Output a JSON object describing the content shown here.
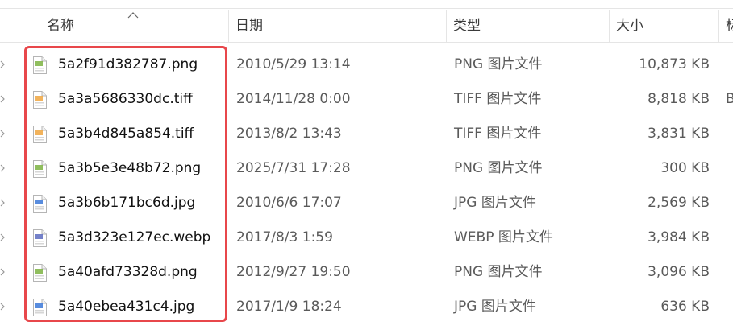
{
  "columns": {
    "name": "名称",
    "date": "日期",
    "type": "类型",
    "size": "大小",
    "more": "标"
  },
  "files": [
    {
      "name": "5a2f91d382787.png",
      "date": "2010/5/29 13:14",
      "type": "PNG 图片文件",
      "size": "10,873 KB",
      "extra": "",
      "icon": "png-file-icon",
      "icon_color": "#7cb342"
    },
    {
      "name": "5a3a5686330dc.tiff",
      "date": "2014/11/28 0:00",
      "type": "TIFF 图片文件",
      "size": "8,818 KB",
      "extra": "B",
      "icon": "tiff-file-icon",
      "icon_color": "#f0a640"
    },
    {
      "name": "5a3b4d845a854.tiff",
      "date": "2013/8/2 13:43",
      "type": "TIFF 图片文件",
      "size": "3,831 KB",
      "extra": "",
      "icon": "tiff-file-icon",
      "icon_color": "#f0a640"
    },
    {
      "name": "5a3b5e3e48b72.png",
      "date": "2025/7/31 17:28",
      "type": "PNG 图片文件",
      "size": "300 KB",
      "extra": "",
      "icon": "png-file-icon",
      "icon_color": "#7cb342"
    },
    {
      "name": "5a3b6b171bc6d.jpg",
      "date": "2010/6/6 17:07",
      "type": "JPG 图片文件",
      "size": "2,569 KB",
      "extra": "",
      "icon": "jpg-file-icon",
      "icon_color": "#3b78d8"
    },
    {
      "name": "5a3d323e127ec.webp",
      "date": "2017/8/3 1:59",
      "type": "WEBP 图片文件",
      "size": "3,984 KB",
      "extra": "",
      "icon": "webp-file-icon",
      "icon_color": "#5c6bc0"
    },
    {
      "name": "5a40afd73328d.png",
      "date": "2012/9/27 19:50",
      "type": "PNG 图片文件",
      "size": "3,096 KB",
      "extra": "",
      "icon": "png-file-icon",
      "icon_color": "#7cb342"
    },
    {
      "name": "5a40ebea431c4.jpg",
      "date": "2017/1/9 18:24",
      "type": "JPG 图片文件",
      "size": "636 KB",
      "extra": "",
      "icon": "jpg-file-icon",
      "icon_color": "#3b78d8"
    }
  ],
  "colors": {
    "highlight": "#e8474b",
    "header_border": "#e5e5e5",
    "secondary_text": "#5a5a5a"
  },
  "sort": {
    "column": "name",
    "direction": "ascending",
    "icon": "sort-up-icon"
  }
}
